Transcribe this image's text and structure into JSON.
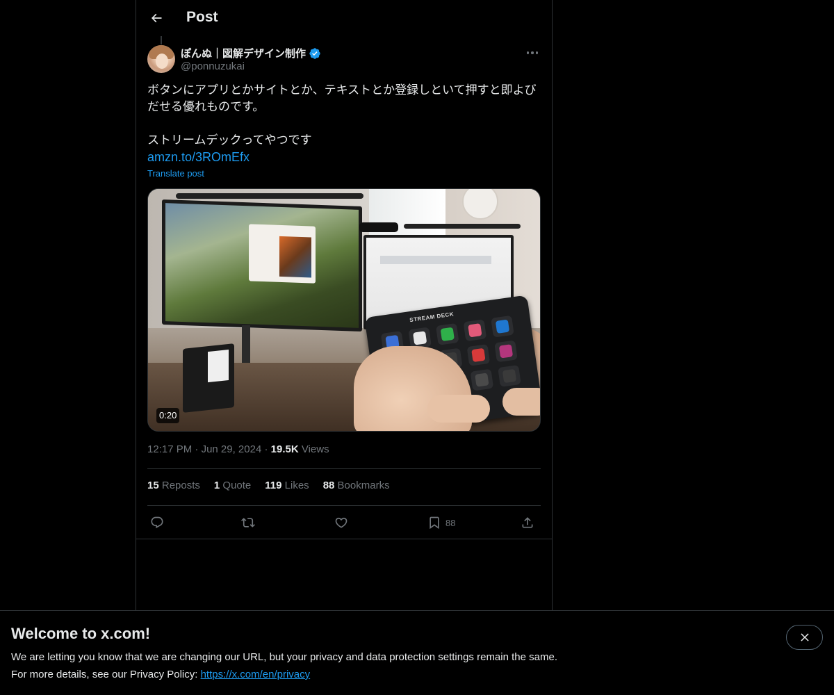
{
  "header": {
    "title": "Post"
  },
  "author": {
    "name": "ぽんぬ｜図解デザイン制作",
    "handle": "@ponnuzukai"
  },
  "post": {
    "text_line1": "ボタンにアプリとかサイトとか、テキストとか登録しといて押すと即よびだせる優れものです。",
    "text_line2": "ストリームデックってやつです",
    "link": "amzn.to/3ROmEfx",
    "translate": "Translate post",
    "media": {
      "duration": "0:20",
      "device_brand": "STREAM DECK",
      "key_colors": [
        "#3b6fd6",
        "#e8e8e8",
        "#2fb04a",
        "#e35a7a",
        "#1f77d0",
        "#2b7ad0",
        "#d62a4e",
        "#3a3a3a",
        "#d83a3a",
        "#b4367d",
        "#1c3a86",
        "#6a2fb0",
        "#f2c543",
        "#4a4a4a",
        "#3a3a3a"
      ]
    }
  },
  "meta": {
    "time": "12:17 PM",
    "date": "Jun 29, 2024",
    "views_count": "19.5K",
    "views_label": "Views"
  },
  "stats": {
    "reposts_count": "15",
    "reposts_label": "Reposts",
    "quotes_count": "1",
    "quotes_label": "Quote",
    "likes_count": "119",
    "likes_label": "Likes",
    "bookmarks_count": "88",
    "bookmarks_label": "Bookmarks"
  },
  "actions": {
    "reply_icon": "reply-icon",
    "repost_icon": "repost-icon",
    "like_icon": "heart-icon",
    "bookmark_icon": "bookmark-icon",
    "bookmark_count": "88",
    "share_icon": "share-icon"
  },
  "banner": {
    "title": "Welcome to x.com!",
    "text1": "We are letting you know that we are changing our URL, but your privacy and data protection settings remain the same.",
    "text2_prefix": "For more details, see our Privacy Policy: ",
    "link": "https://x.com/en/privacy"
  },
  "colors": {
    "background": "#000000",
    "text": "#e7e9ea",
    "muted": "#71767b",
    "accent": "#1d9bf0",
    "border": "#2f3336"
  }
}
